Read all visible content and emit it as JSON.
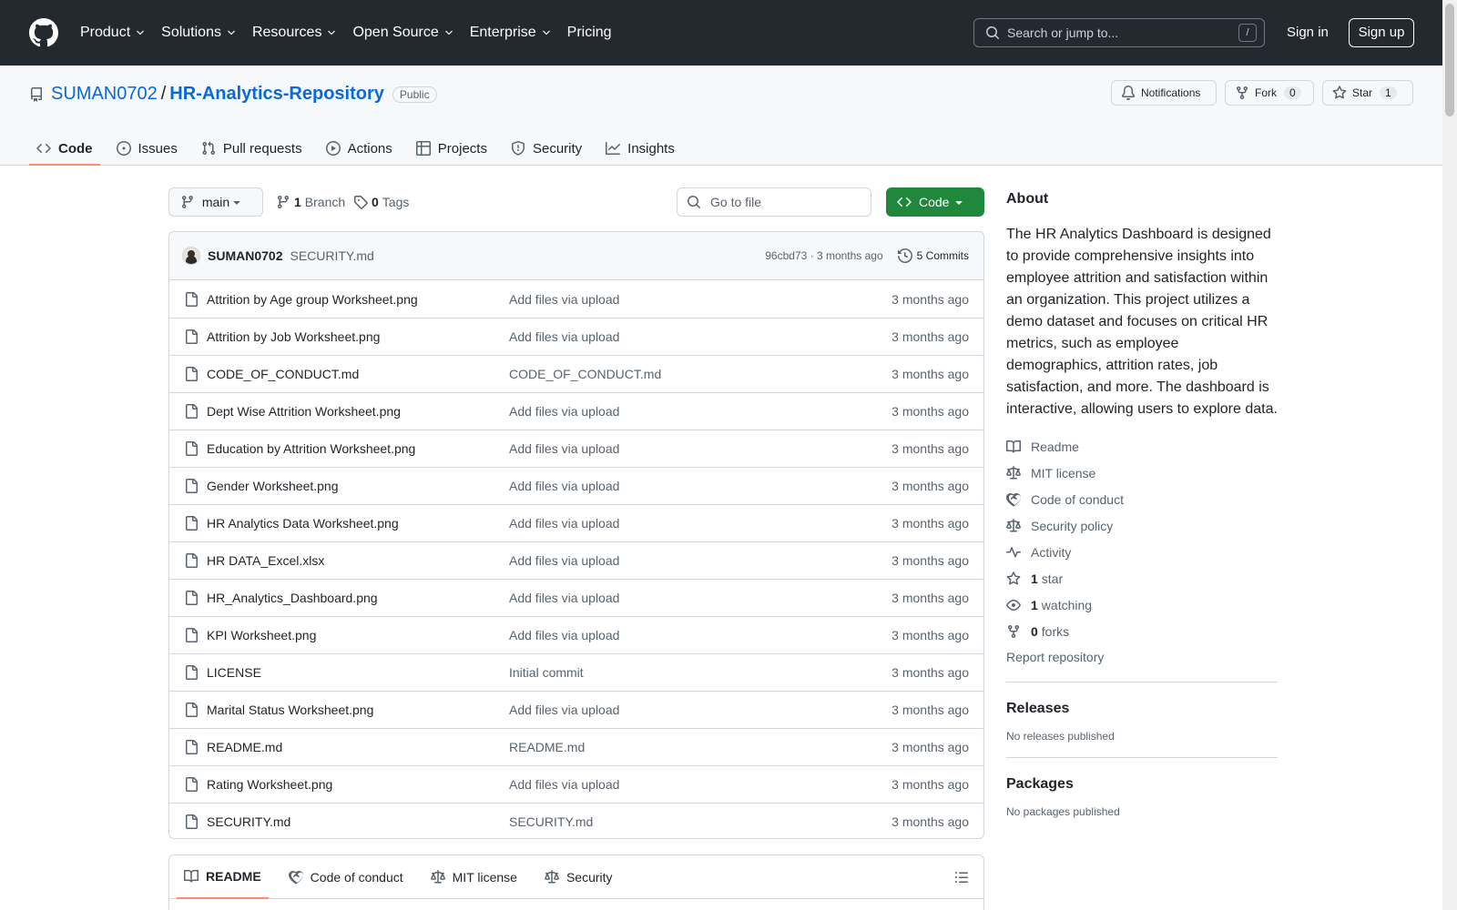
{
  "header": {
    "nav": [
      "Product",
      "Solutions",
      "Resources",
      "Open Source",
      "Enterprise",
      "Pricing"
    ],
    "search_placeholder": "Search or jump to...",
    "search_shortcut": "/",
    "sign_in": "Sign in",
    "sign_up": "Sign up"
  },
  "repo": {
    "owner": "SUMAN0702",
    "separator": "/",
    "name": "HR-Analytics-Repository",
    "visibility": "Public",
    "notifications_label": "Notifications",
    "fork_label": "Fork",
    "fork_count": "0",
    "star_label": "Star",
    "star_count": "1",
    "tabs": [
      "Code",
      "Issues",
      "Pull requests",
      "Actions",
      "Projects",
      "Security",
      "Insights"
    ]
  },
  "browser": {
    "branch": "main",
    "branch_count": "1",
    "branch_label": "Branch",
    "tag_count": "0",
    "tag_label": "Tags",
    "goto_placeholder": "Go to file",
    "code_button": "Code",
    "commit": {
      "author": "SUMAN0702",
      "message": "SECURITY.md",
      "meta": "96cbd73 · 3 months ago",
      "commits_label": "5 Commits"
    },
    "files": [
      {
        "name": "Attrition by Age group Worksheet.png",
        "commit": "Add files via upload",
        "date": "3 months ago"
      },
      {
        "name": "Attrition by Job Worksheet.png",
        "commit": "Add files via upload",
        "date": "3 months ago"
      },
      {
        "name": "CODE_OF_CONDUCT.md",
        "commit": "CODE_OF_CONDUCT.md",
        "date": "3 months ago"
      },
      {
        "name": "Dept Wise Attrition Worksheet.png",
        "commit": "Add files via upload",
        "date": "3 months ago"
      },
      {
        "name": "Education by Attrition Worksheet.png",
        "commit": "Add files via upload",
        "date": "3 months ago"
      },
      {
        "name": "Gender Worksheet.png",
        "commit": "Add files via upload",
        "date": "3 months ago"
      },
      {
        "name": "HR Analytics Data Worksheet.png",
        "commit": "Add files via upload",
        "date": "3 months ago"
      },
      {
        "name": "HR DATA_Excel.xlsx",
        "commit": "Add files via upload",
        "date": "3 months ago"
      },
      {
        "name": "HR_Analytics_Dashboard.png",
        "commit": "Add files via upload",
        "date": "3 months ago"
      },
      {
        "name": "KPI Worksheet.png",
        "commit": "Add files via upload",
        "date": "3 months ago"
      },
      {
        "name": "LICENSE",
        "commit": "Initial commit",
        "date": "3 months ago"
      },
      {
        "name": "Marital Status Worksheet.png",
        "commit": "Add files via upload",
        "date": "3 months ago"
      },
      {
        "name": "README.md",
        "commit": "README.md",
        "date": "3 months ago"
      },
      {
        "name": "Rating Worksheet.png",
        "commit": "Add files via upload",
        "date": "3 months ago"
      },
      {
        "name": "SECURITY.md",
        "commit": "SECURITY.md",
        "date": "3 months ago"
      }
    ],
    "readme_tabs": [
      "README",
      "Code of conduct",
      "MIT license",
      "Security"
    ]
  },
  "about": {
    "title": "About",
    "description": "The HR Analytics Dashboard is designed to provide comprehensive insights into employee attrition and satisfaction within an organization. This project utilizes a demo dataset and focuses on critical HR metrics, such as employee demographics, attrition rates, job satisfaction, and more. The dashboard is interactive, allowing users to explore data.",
    "readme": "Readme",
    "license": "MIT license",
    "conduct": "Code of conduct",
    "security_policy": "Security policy",
    "activity": "Activity",
    "stars_count": "1",
    "stars_label": "star",
    "watching_count": "1",
    "watching_label": "watching",
    "forks_count": "0",
    "forks_label": "forks",
    "report": "Report repository"
  },
  "releases": {
    "title": "Releases",
    "empty": "No releases published"
  },
  "packages": {
    "title": "Packages",
    "empty": "No packages published"
  },
  "icons": {
    "github_logo": "github-logo-icon",
    "file": "file-icon",
    "branch": "git-branch-icon",
    "tag": "tag-icon",
    "history": "history-icon",
    "book": "book-icon",
    "law": "law-icon",
    "heart": "code-of-conduct-icon",
    "pulse": "pulse-icon",
    "star": "star-icon",
    "eye": "eye-icon",
    "fork": "repo-forked-icon"
  },
  "colors": {
    "header_bg": "#24292f",
    "link": "#0969da",
    "primary_button": "#1f883d",
    "active_tab_underline": "#fd8c73"
  }
}
